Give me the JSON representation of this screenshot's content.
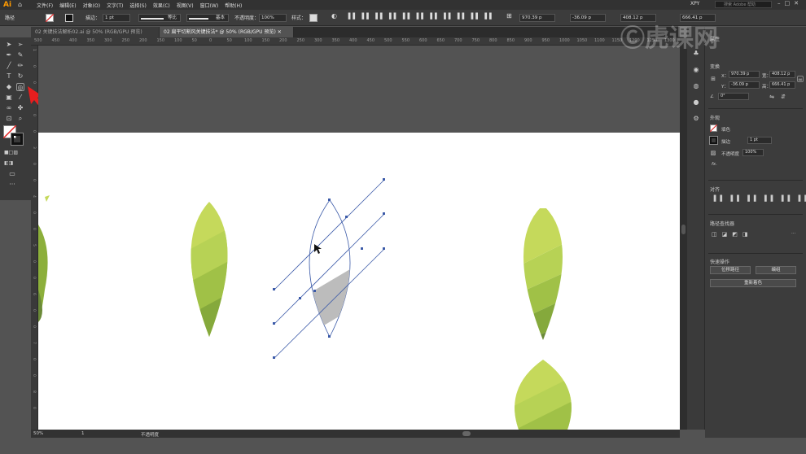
{
  "app": {
    "logo": "Ai",
    "menus": [
      "文件(F)",
      "编辑(E)",
      "对象(O)",
      "文字(T)",
      "选择(S)",
      "效果(C)",
      "视图(V)",
      "窗口(W)",
      "帮助(H)"
    ],
    "workspace": "XPY",
    "search_placeholder": "搜索 Adobe 帮助"
  },
  "control_bar": {
    "object_label": "路径",
    "stroke_label": "描边：",
    "stroke_weight": "1 pt",
    "stroke_profile": "等比",
    "brush": "基本",
    "opacity_label": "不透明度：",
    "opacity_value": "100%",
    "style_label": "样式：",
    "x_value": "970.39 p",
    "y_value": "-36.09 p",
    "w_value": "408.12 p",
    "h_value": "666.41 p"
  },
  "tabs": [
    {
      "label": "02 关键技法解析02.ai @ 50% (RGB/GPU 预览)",
      "active": false
    },
    {
      "label": "02 扁平切割风关键技法* @ 50% (RGB/GPU 预览)",
      "active": true
    }
  ],
  "ruler_top_ticks": [
    "500",
    "450",
    "400",
    "350",
    "300",
    "250",
    "200",
    "150",
    "100",
    "50",
    "0",
    "50",
    "100",
    "150",
    "200",
    "250",
    "300",
    "350",
    "400",
    "450",
    "500",
    "550",
    "600",
    "650",
    "700",
    "750",
    "800",
    "850",
    "900",
    "950",
    "1000",
    "1050",
    "1100",
    "1150",
    "1200",
    "1250",
    "1300"
  ],
  "ruler_left_ticks": [
    "1",
    "0",
    "0",
    "2",
    "0",
    "0",
    "3",
    "0",
    "0",
    "4",
    "0",
    "0",
    "5",
    "0",
    "0",
    "6",
    "0",
    "0",
    "7",
    "0",
    "0",
    "8",
    "0"
  ],
  "watermark": "虎课网",
  "status": {
    "zoom": "50%",
    "artboard": "1",
    "tool_status": "不透明度"
  },
  "props": {
    "tabs": [
      "属性",
      "图层",
      "库"
    ],
    "transform_header": "变换",
    "x_label": "X：",
    "x": "970.39 p",
    "y_label": "Y：",
    "y": "-36.09 p",
    "w_label": "宽：",
    "w": "408.12 p",
    "h_label": "高：",
    "h": "666.41 p",
    "rotate": "0°",
    "appearance_header": "外观",
    "fill_label": "填色",
    "stroke_label": "描边",
    "stroke_weight": "1 pt",
    "opacity_label": "不透明度",
    "opacity_value": "100%",
    "fx": "fx.",
    "align_header": "对齐",
    "pathfinder_header": "路径查找器",
    "quick_header": "快速操作",
    "btn_offset": "位移路径",
    "btn_group": "编组",
    "btn_recolor": "重新着色"
  },
  "colors": {
    "leaf_light": "#c5d95b",
    "leaf_mid": "#a7c64a",
    "leaf_dark": "#8caf3b",
    "leaf_darkest": "#6b8a38",
    "path_blue": "#3b5aa8",
    "shape_gray": "#bcbcbc"
  }
}
